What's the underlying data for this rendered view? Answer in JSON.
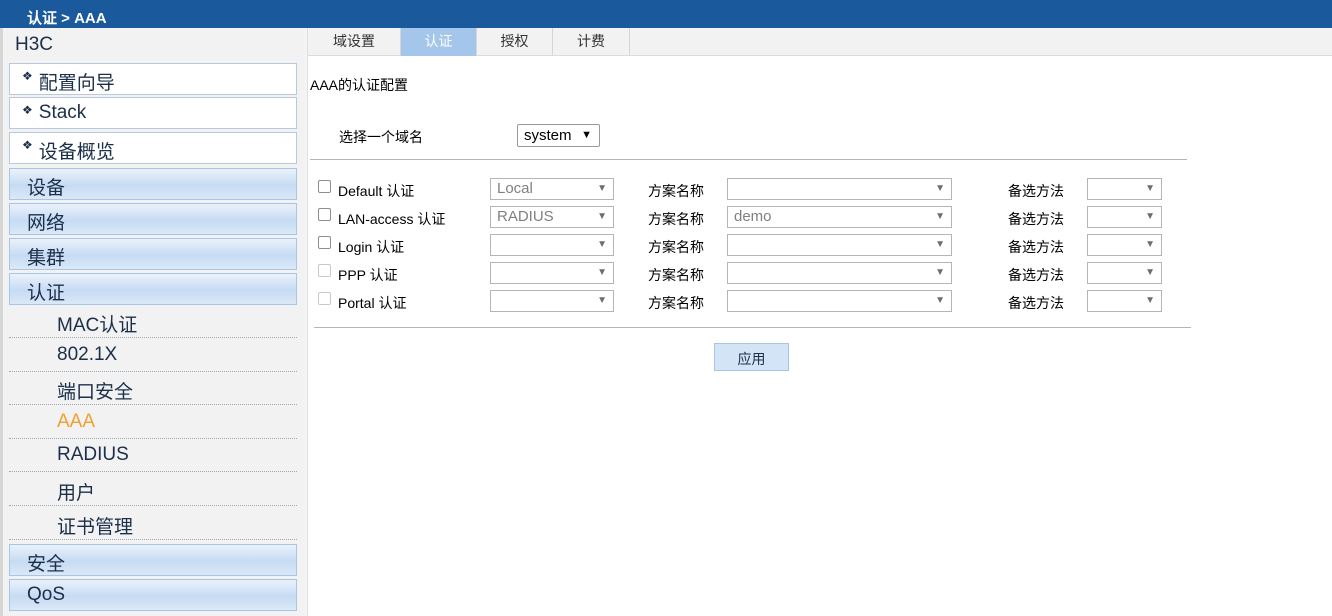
{
  "breadcrumb": "认证 > AAA",
  "sidebar": {
    "brand": "H3C",
    "wizard_items": [
      {
        "label": "配置向导"
      },
      {
        "label": "Stack"
      },
      {
        "label": "设备概览"
      }
    ],
    "categories_top": [
      {
        "label": "设备"
      },
      {
        "label": "网络"
      },
      {
        "label": "集群"
      },
      {
        "label": "认证"
      }
    ],
    "sub_items": [
      {
        "label": "MAC认证"
      },
      {
        "label": "802.1X"
      },
      {
        "label": "端口安全"
      },
      {
        "label": "AAA",
        "active": true
      },
      {
        "label": "RADIUS"
      },
      {
        "label": "用户"
      },
      {
        "label": "证书管理"
      }
    ],
    "categories_bottom": [
      {
        "label": "安全"
      },
      {
        "label": "QoS"
      }
    ]
  },
  "tabs": [
    {
      "label": "域设置",
      "active": false
    },
    {
      "label": "认证",
      "active": true
    },
    {
      "label": "授权",
      "active": false
    },
    {
      "label": "计费",
      "active": false
    }
  ],
  "main": {
    "section_title": "AAA的认证配置",
    "domain_label": "选择一个域名",
    "domain_value": "system",
    "scheme_label": "方案名称",
    "alt_label": "备选方法",
    "rows": [
      {
        "label": "Default 认证",
        "method": "Local",
        "scheme": "",
        "alt": "",
        "enabled": true
      },
      {
        "label": "LAN-access 认证",
        "method": "RADIUS",
        "scheme": "demo",
        "alt": "",
        "enabled": true
      },
      {
        "label": "Login 认证",
        "method": "",
        "scheme": "",
        "alt": "",
        "enabled": true
      },
      {
        "label": "PPP 认证",
        "method": "",
        "scheme": "",
        "alt": "",
        "enabled": false
      },
      {
        "label": "Portal 认证",
        "method": "",
        "scheme": "",
        "alt": "",
        "enabled": false
      }
    ],
    "apply_label": "应用"
  },
  "colors": {
    "topbar": "#1a5a9c",
    "active_tab": "#a4c6ea",
    "active_nav": "#f0a030"
  }
}
